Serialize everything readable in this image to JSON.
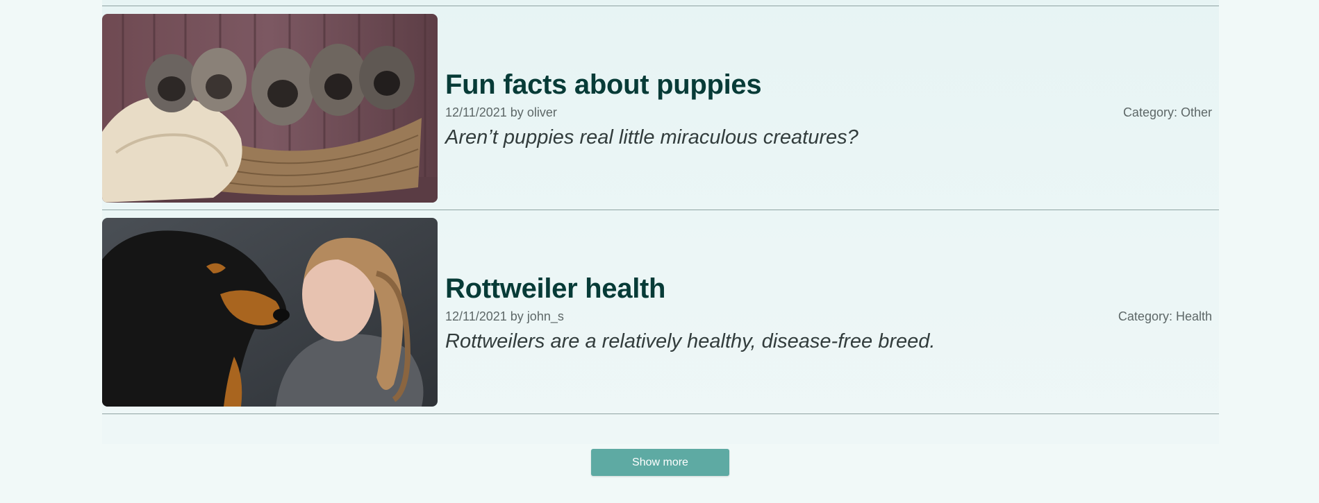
{
  "posts": [
    {
      "title": "Fun facts about puppies",
      "date": "12/11/2021",
      "by": "by",
      "author": "oliver",
      "category": "Category: Other",
      "excerpt": "Aren’t puppies real little miraculous creatures?",
      "image": "puppies-in-basket-photo"
    },
    {
      "title": "Rottweiler health",
      "date": "12/11/2021",
      "by": "by",
      "author": "john_s",
      "category": "Category: Health",
      "excerpt": "Rottweilers are a relatively healthy, disease-free breed.",
      "image": "rottweiler-and-woman-photo"
    }
  ],
  "show_more_label": "Show more",
  "colors": {
    "accent": "#5eaaa3",
    "title": "#073b37",
    "background": "#f1f9f8"
  }
}
